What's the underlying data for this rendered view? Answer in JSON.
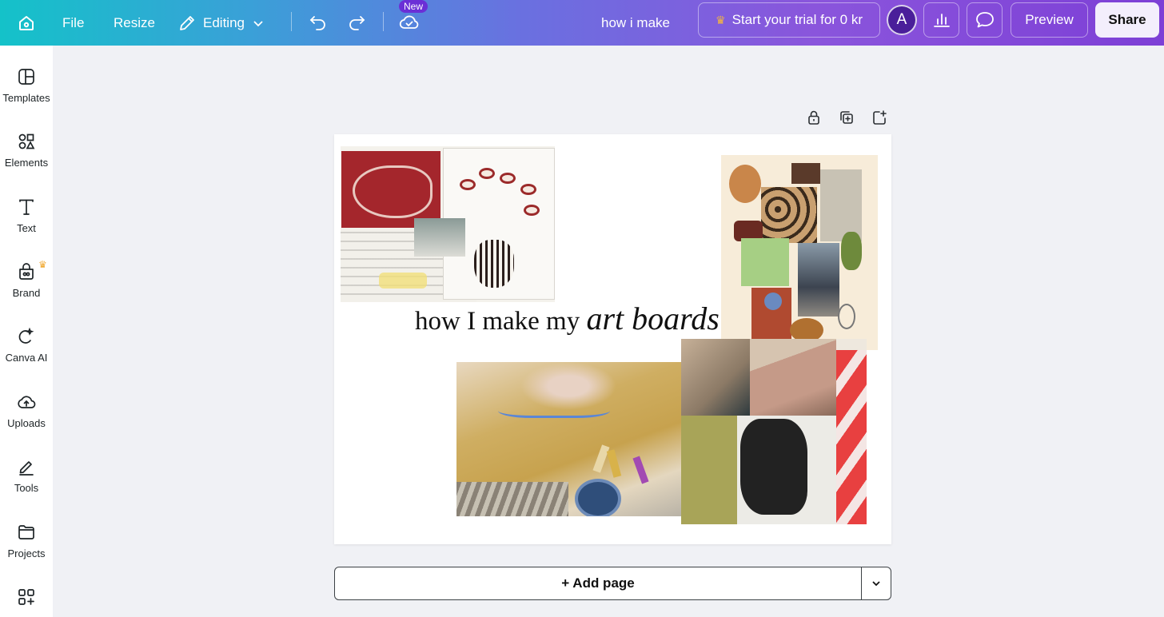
{
  "topbar": {
    "file_label": "File",
    "resize_label": "Resize",
    "editing_label": "Editing",
    "new_badge": "New",
    "doc_title": "how i make",
    "trial_label": "Start your trial for 0 kr",
    "avatar_initial": "A",
    "preview_label": "Preview",
    "share_label": "Share"
  },
  "sidebar": {
    "items": [
      {
        "label": "Templates",
        "icon": "templates-icon"
      },
      {
        "label": "Elements",
        "icon": "elements-icon"
      },
      {
        "label": "Text",
        "icon": "text-icon"
      },
      {
        "label": "Brand",
        "icon": "brand-icon"
      },
      {
        "label": "Canva AI",
        "icon": "canva-ai-icon"
      },
      {
        "label": "Uploads",
        "icon": "uploads-icon"
      },
      {
        "label": "Tools",
        "icon": "tools-icon"
      },
      {
        "label": "Projects",
        "icon": "projects-icon"
      },
      {
        "label": "",
        "icon": "apps-icon"
      }
    ]
  },
  "canvas": {
    "title_plain": "how I make my ",
    "title_italic": "art boards"
  },
  "footer": {
    "add_page_label": "+ Add page"
  },
  "colors": {
    "gradient_start": "#14c2c9",
    "gradient_end": "#7d3fd6",
    "crown": "#f6b73c",
    "new_badge": "#6b2fd6"
  }
}
